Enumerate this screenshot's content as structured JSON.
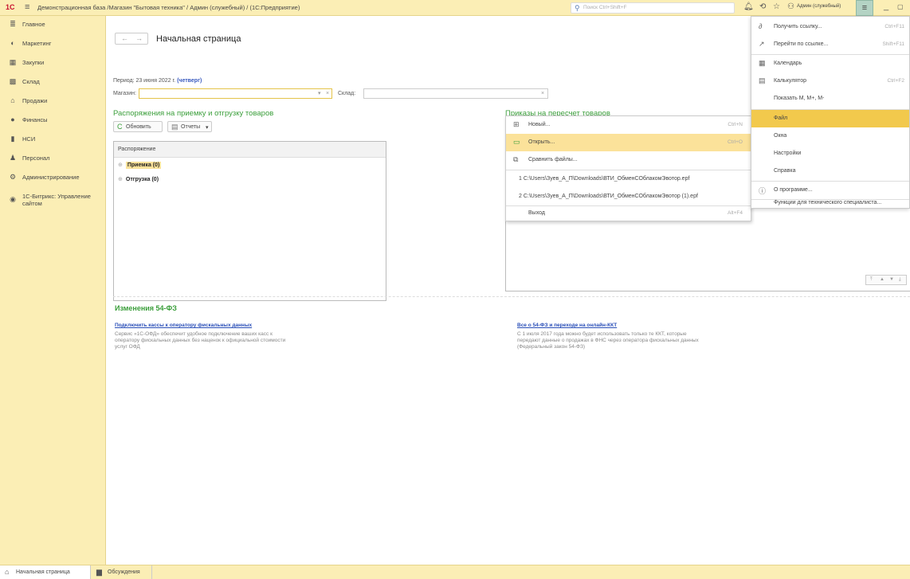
{
  "titlebar": {
    "logo": "1С",
    "title": "Демонстрационная база /Магазин \"Бытовая техника\" / Админ (служебный) /  (1С:Предприятие)",
    "search_placeholder": "Поиск Ctrl+Shift+F",
    "user": "Админ (служебный)"
  },
  "sidebar": {
    "items": [
      {
        "label": "Главное",
        "icon": "menu-lines-icon"
      },
      {
        "label": "Маркетинг",
        "icon": "marketing-icon"
      },
      {
        "label": "Закупки",
        "icon": "purchases-icon"
      },
      {
        "label": "Склад",
        "icon": "warehouse-icon"
      },
      {
        "label": "Продажи",
        "icon": "sales-icon"
      },
      {
        "label": "Финансы",
        "icon": "finance-icon"
      },
      {
        "label": "НСИ",
        "icon": "reference-book-icon"
      },
      {
        "label": "Персонал",
        "icon": "person-icon"
      },
      {
        "label": "Администрирование",
        "icon": "gear-icon"
      },
      {
        "label": "1С-Битрикс: Управление сайтом",
        "icon": "bitrix-icon"
      }
    ]
  },
  "page": {
    "title": "Начальная страница",
    "period_label": "Период:",
    "period_date": "23 июня 2022 г.",
    "period_weekday": "(четверг)",
    "shop_label": "Магазин:",
    "shop_value": "",
    "warehouse_label": "Склад:",
    "warehouse_value": ""
  },
  "left_section": {
    "title": "Распоряжения на приемку и отгрузку товаров",
    "refresh_label": "Обновить",
    "reports_label": "Отчеты",
    "column_header": "Распоряжение",
    "rows": [
      {
        "label": "Приемка (0)"
      },
      {
        "label": "Отгрузка (0)"
      }
    ]
  },
  "right_section": {
    "title": "Приказы на пересчет товаров"
  },
  "news": {
    "title": "Изменения 54-ФЗ",
    "items": [
      {
        "link": "Подключить кассы к оператору фискальных данных",
        "text": "Сервис «1С-ОФД» обеспечит удобное подключение ваших касс к оператору фискальных данных без наценок к официальной стоимости услуг ОФД"
      },
      {
        "link": "Все о 54-ФЗ и переходе на онлайн-ККТ",
        "text": "С 1 июля 2017 года можно будет использовать только те ККТ, которые передают данные о продажах в ФНС через оператора фискальных данных (Федеральный закон 54-ФЗ)"
      }
    ]
  },
  "file_menu": {
    "items": [
      {
        "label": "Новый...",
        "shortcut": "Ctrl+N",
        "icon": "new-file-icon"
      },
      {
        "label": "Открыть...",
        "shortcut": "Ctrl+O",
        "icon": "open-folder-icon"
      },
      {
        "label": "Сравнить файлы...",
        "shortcut": "",
        "icon": "compare-files-icon"
      },
      {
        "label": "1 C:\\Users\\Зуев_А_П\\Downloads\\ВТИ_ОбменСОблакомЭвотор.epf",
        "shortcut": ""
      },
      {
        "label": "2 C:\\Users\\Зуев_А_П\\Downloads\\ВТИ_ОбменСОблакомЭвотор (1).epf",
        "shortcut": ""
      },
      {
        "label": "Выход",
        "shortcut": "Alt+F4"
      }
    ]
  },
  "main_menu": {
    "items": [
      {
        "label": "Получить ссылку...",
        "shortcut": "Ctrl+F11",
        "icon": "link-icon"
      },
      {
        "label": "Перейти по ссылке...",
        "shortcut": "Shift+F11",
        "icon": "follow-link-icon"
      },
      {
        "label": "Календарь",
        "shortcut": "",
        "icon": "calendar-icon"
      },
      {
        "label": "Калькулятор",
        "shortcut": "Ctrl+F2",
        "icon": "calculator-icon"
      },
      {
        "label": "Показать M, M+, M-",
        "shortcut": ""
      },
      {
        "label": "Файл",
        "shortcut": ""
      },
      {
        "label": "Окна",
        "shortcut": ""
      },
      {
        "label": "Настройки",
        "shortcut": ""
      },
      {
        "label": "Справка",
        "shortcut": ""
      },
      {
        "label": "О программе...",
        "shortcut": "",
        "icon": "info-icon"
      },
      {
        "label": "Функции для технического специалиста...",
        "shortcut": ""
      }
    ]
  },
  "bottombar": {
    "tabs": [
      {
        "label": "Начальная страница",
        "icon": "home-icon"
      },
      {
        "label": "Обсуждения",
        "icon": "chat-icon"
      }
    ]
  }
}
